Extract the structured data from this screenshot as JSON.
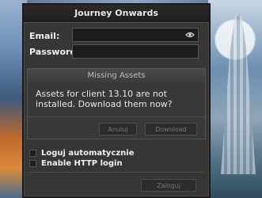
{
  "window": {
    "title": "Journey Onwards"
  },
  "login": {
    "email_label": "Email:",
    "email_value": "",
    "password_label": "Password:",
    "password_value": ""
  },
  "dialog": {
    "title": "Missing Assets",
    "message": "Assets for client 13.10 are not installed. Download them now?",
    "cancel_label": "Anuluj",
    "download_label": "Download"
  },
  "options": {
    "auto_login_label": "Loguj automatycznie",
    "auto_login_checked": false,
    "http_login_label": "Enable HTTP login",
    "http_login_checked": false
  },
  "actions": {
    "login_label": "Zaloguj"
  },
  "icons": {
    "show_password": "eye-icon"
  }
}
